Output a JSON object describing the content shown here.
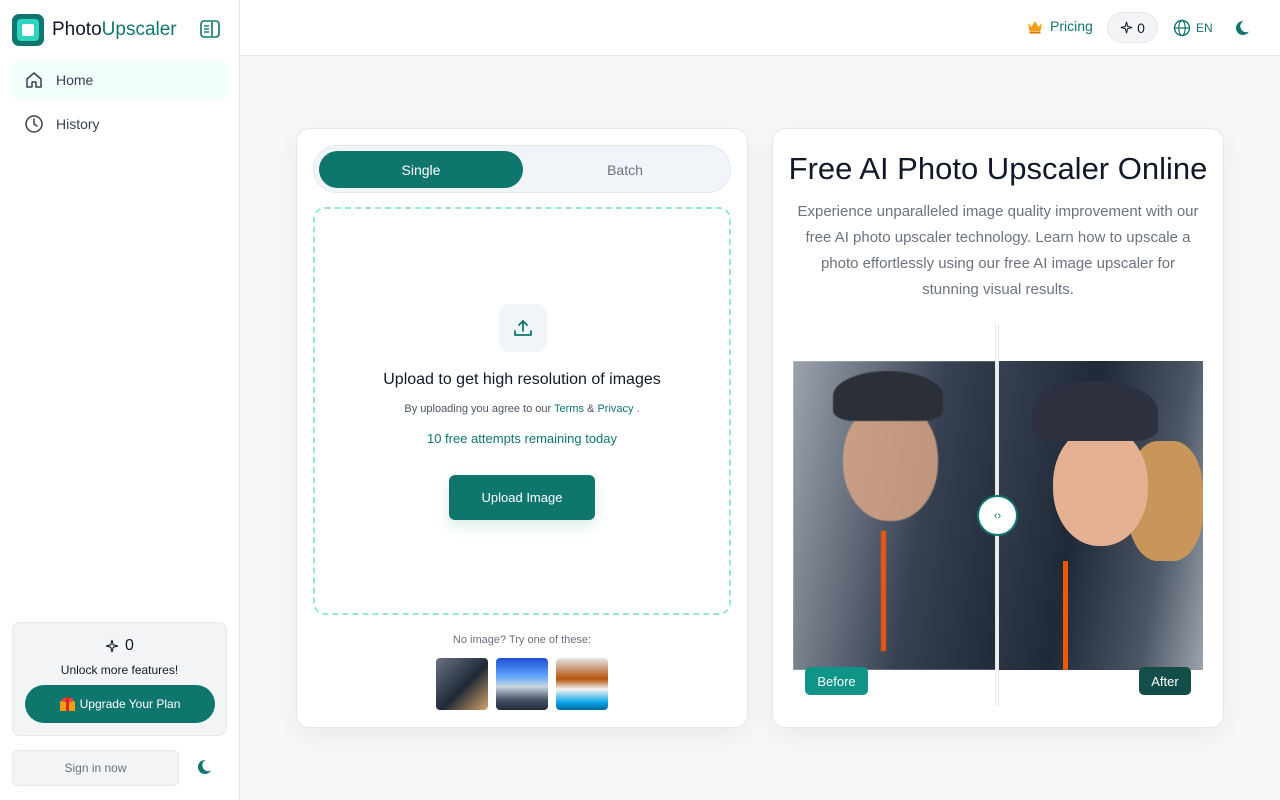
{
  "brand": {
    "name_part1": "Photo",
    "name_part2": "Upscaler"
  },
  "sidebar": {
    "items": [
      {
        "label": "Home",
        "icon": "home-icon"
      },
      {
        "label": "History",
        "icon": "clock-icon"
      }
    ],
    "credits_count": "0",
    "unlock_text": "Unlock more features!",
    "upgrade_label": "Upgrade Your Plan",
    "signin_label": "Sign in now"
  },
  "header": {
    "pricing_label": "Pricing",
    "credits_count": "0",
    "language": "EN"
  },
  "upload": {
    "tabs": [
      {
        "label": "Single"
      },
      {
        "label": "Batch"
      }
    ],
    "title": "Upload to get high resolution of images",
    "agree_prefix": "By uploading you agree to our",
    "terms_label": "Terms",
    "amp": "&",
    "privacy_label": "Privacy",
    "period": ".",
    "free_attempts": "10 free attempts remaining today",
    "button_label": "Upload Image",
    "no_image_text": "No image? Try one of these:"
  },
  "info": {
    "title": "Free AI Photo Upscaler Online",
    "description": "Experience unparalleled image quality improvement with our free AI photo upscaler technology. Learn how to upscale a photo effortlessly using our free AI image upscaler for stunning visual results.",
    "before_label": "Before",
    "after_label": "After",
    "handle_glyph": "‹›"
  },
  "colors": {
    "primary": "#0f766e",
    "accent_light": "#f0fdfa",
    "dash": "#99e6cf"
  }
}
